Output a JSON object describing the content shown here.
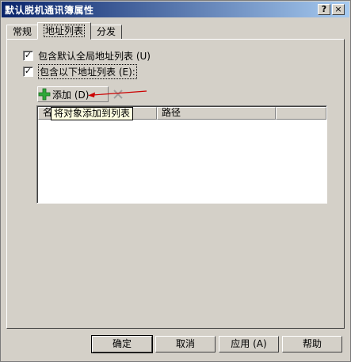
{
  "window": {
    "title": "默认脱机通讯簿属性"
  },
  "title_buttons": {
    "help": "?",
    "close": "×"
  },
  "tabs": [
    {
      "label": "常规",
      "active": false
    },
    {
      "label": "地址列表",
      "active": true
    },
    {
      "label": "分发",
      "active": false
    }
  ],
  "checkboxes": [
    {
      "label": "包含默认全局地址列表 (U)",
      "checked": true
    },
    {
      "label": "包含以下地址列表 (E):",
      "checked": true
    }
  ],
  "toolbar": {
    "add_label": "添加 (D)",
    "add_icon": "plus-icon",
    "remove_icon": "x-icon"
  },
  "list": {
    "columns": [
      "名",
      "路径"
    ]
  },
  "tooltip": "将对象添加到列表",
  "buttons": {
    "ok": "确定",
    "cancel": "取消",
    "apply": "应用 (A)",
    "help": "帮助"
  },
  "colors": {
    "title_start": "#0a246a",
    "title_end": "#a6caf0",
    "add_icon": "#2fa83a",
    "arrow": "#cc0000"
  }
}
